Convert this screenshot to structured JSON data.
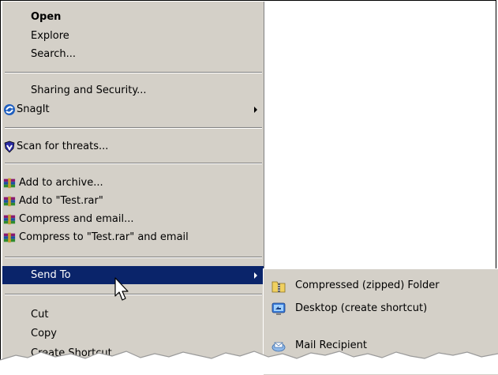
{
  "context_menu": {
    "items": [
      {
        "label": "Open"
      },
      {
        "label": "Explore"
      },
      {
        "label": "Search..."
      },
      {
        "label": "Sharing and Security..."
      },
      {
        "label": "SnagIt",
        "icon": "snagit-icon"
      },
      {
        "label": "Scan for threats...",
        "icon": "shield-icon"
      },
      {
        "label": "Add to archive...",
        "icon": "winrar-icon"
      },
      {
        "label": "Add to \"Test.rar\"",
        "icon": "winrar-icon"
      },
      {
        "label": "Compress and email...",
        "icon": "winrar-icon"
      },
      {
        "label": "Compress to \"Test.rar\" and email",
        "icon": "winrar-icon"
      },
      {
        "label": "Send To"
      },
      {
        "label": "Cut"
      },
      {
        "label": "Copy"
      },
      {
        "label": "Create Shortcut"
      }
    ]
  },
  "send_to_submenu": {
    "items": [
      {
        "label": "Compressed (zipped) Folder",
        "icon": "zip-folder-icon"
      },
      {
        "label": "Desktop (create shortcut)",
        "icon": "desktop-icon"
      },
      {
        "label": "Mail Recipient",
        "icon": "mail-icon"
      }
    ]
  },
  "colors": {
    "menu_bg": "#d4d0c8",
    "highlight": "#0a246a"
  }
}
